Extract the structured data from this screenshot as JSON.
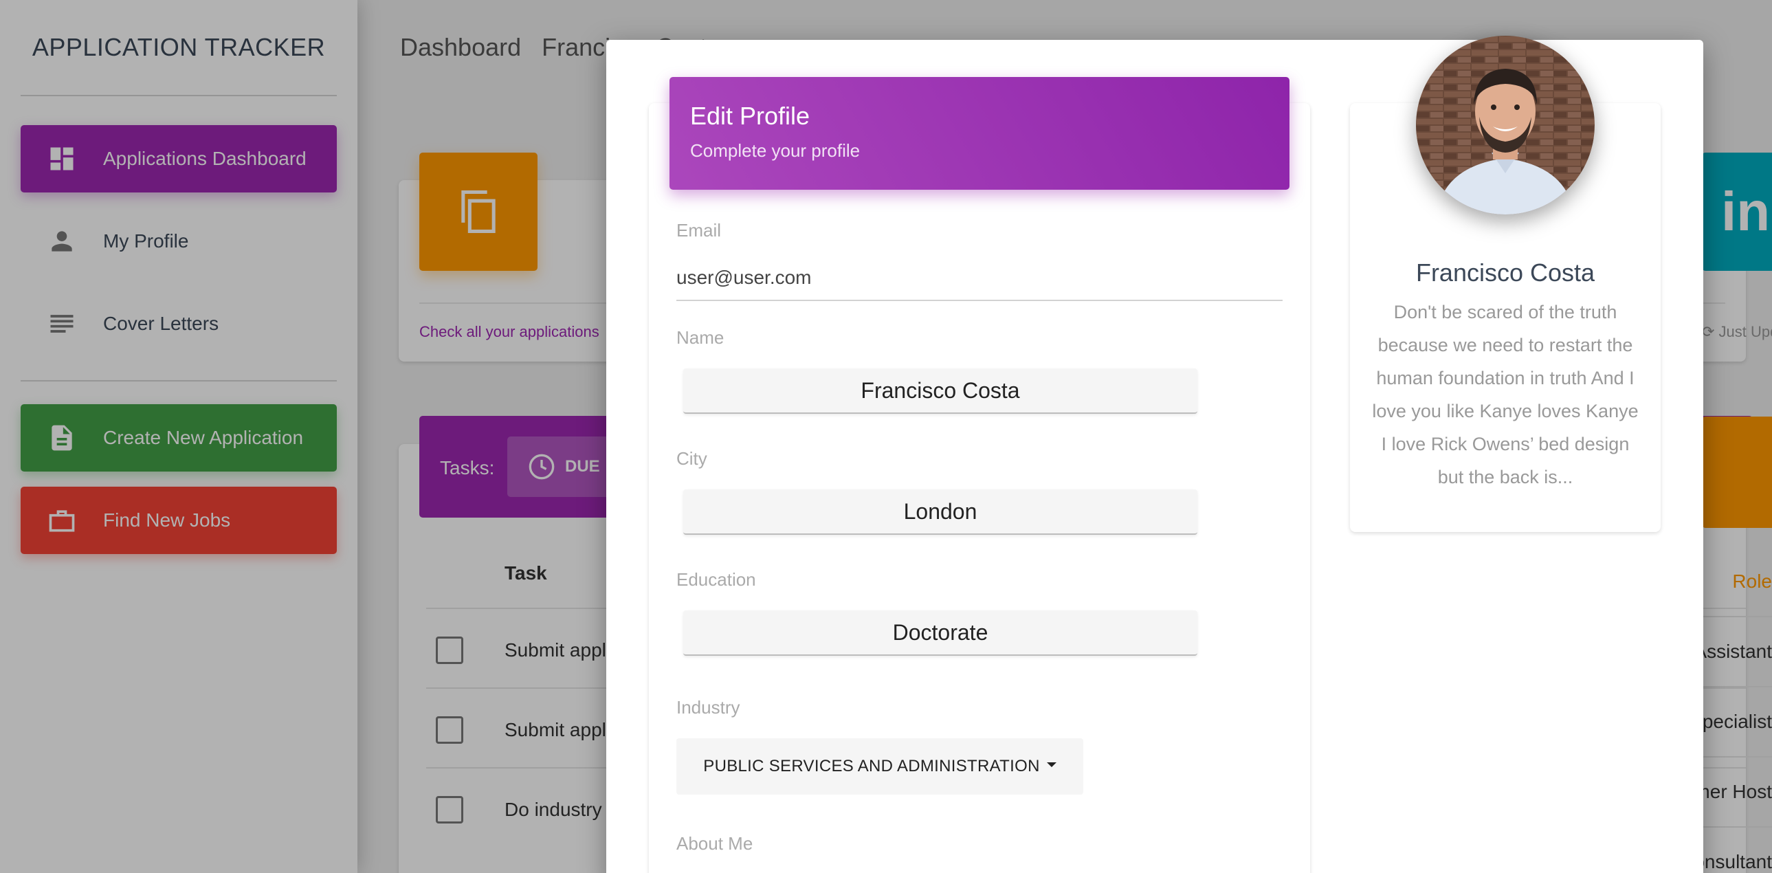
{
  "sidebar": {
    "logo": "APPLICATION TRACKER",
    "nav": [
      {
        "label": "Applications Dashboard"
      },
      {
        "label": "My Profile"
      },
      {
        "label": "Cover Letters"
      }
    ],
    "actions": [
      {
        "label": "Create New Application"
      },
      {
        "label": "Find New Jobs"
      }
    ]
  },
  "topnav": {
    "items": [
      "Dashboard",
      "Francisco Costa"
    ]
  },
  "background": {
    "check_link": "Check all your applications",
    "tasks_label": "Tasks:",
    "due_label": "DUE",
    "task_col": "Task",
    "tasks": [
      "Submit application",
      "Submit application",
      "Do industry research"
    ],
    "right_badge": "Just Updated",
    "right_head": "Role",
    "right_rows": [
      "Accounting Assistant",
      "Community-Specialist",
      "Customer Host",
      "Investor Consultant"
    ]
  },
  "modal": {
    "header": {
      "title": "Edit Profile",
      "subtitle": "Complete your profile"
    },
    "email": {
      "label": "Email",
      "value": "user@user.com"
    },
    "name": {
      "label": "Name",
      "value": "Francisco Costa"
    },
    "city": {
      "label": "City",
      "value": "London"
    },
    "education": {
      "label": "Education",
      "value": "Doctorate"
    },
    "industry": {
      "label": "Industry",
      "value": "PUBLIC SERVICES AND ADMINISTRATION"
    },
    "about": {
      "label": "About Me"
    }
  },
  "profile": {
    "name": "Francisco Costa",
    "bio": "Don't be scared of the truth because we need to restart the human foundation in truth And I love you like Kanye loves Kanye I love Rick Owens’ bed design but the back is..."
  },
  "colors": {
    "primary": "#9c27b0",
    "warning": "#ff9800",
    "success": "#43a047",
    "danger": "#f44336",
    "info": "#00acc1"
  },
  "icons": {
    "dashboard": "dashboard-icon",
    "person": "person-icon",
    "lines": "notes-icon",
    "document": "document-icon",
    "briefcase": "briefcase-icon",
    "copy": "copy-icon",
    "clock": "clock-icon",
    "linkedin": "linkedin-icon",
    "refresh": "refresh-icon"
  }
}
